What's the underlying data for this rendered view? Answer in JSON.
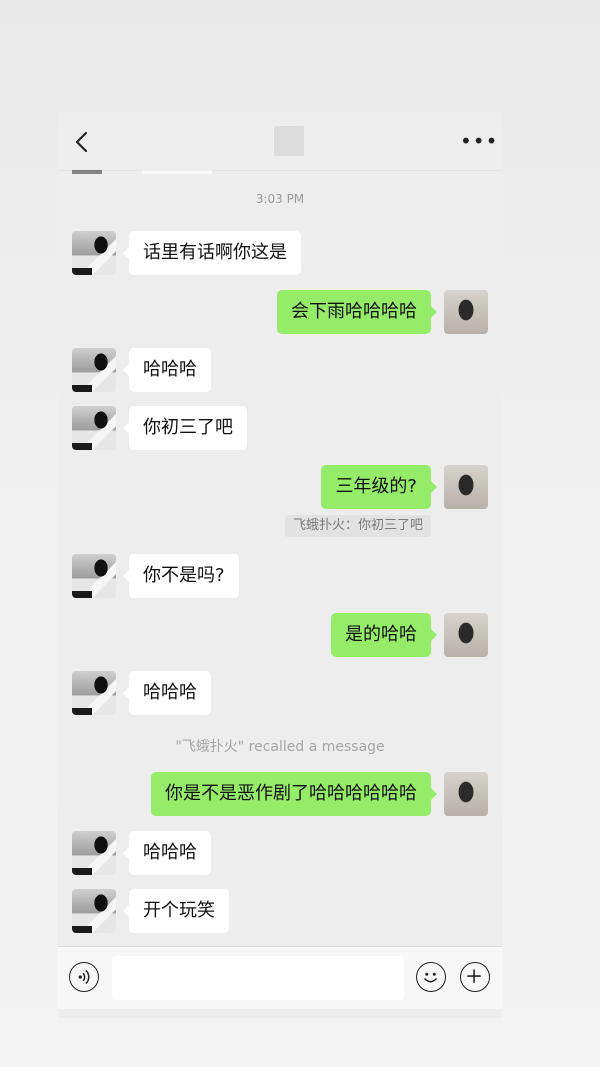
{
  "header": {
    "back_icon": "chevron-left-icon",
    "more_icon": "more-horizontal-icon",
    "more_label": "•••"
  },
  "chat": {
    "timestamp": "3:03 PM",
    "messages": [
      {
        "side": "left",
        "text": "话里有话啊你这是"
      },
      {
        "side": "right",
        "text": "会下雨哈哈哈哈"
      },
      {
        "side": "left",
        "text": "哈哈哈"
      },
      {
        "side": "left",
        "text": "你初三了吧"
      },
      {
        "side": "right",
        "text": "三年级的?"
      },
      {
        "side": "left",
        "text": "你不是吗?"
      },
      {
        "side": "right",
        "text": "是的哈哈"
      },
      {
        "side": "left",
        "text": "哈哈哈"
      },
      {
        "side": "right",
        "text": "你是不是恶作剧了哈哈哈哈哈哈"
      },
      {
        "side": "left",
        "text": "哈哈哈"
      },
      {
        "side": "left",
        "text": "开个玩笑"
      }
    ],
    "quote_text": "飞蛾扑火：你初三了吧",
    "recall_notice": "\"飞蛾扑火\" recalled a message"
  },
  "input_bar": {
    "voice_icon": "voice-icon",
    "input_value": "",
    "emoji_icon": "emoji-icon",
    "plus_icon": "plus-circle-icon"
  },
  "colors": {
    "self_bubble": "#95ec69",
    "other_bubble": "#ffffff",
    "chat_background": "#ededed"
  }
}
